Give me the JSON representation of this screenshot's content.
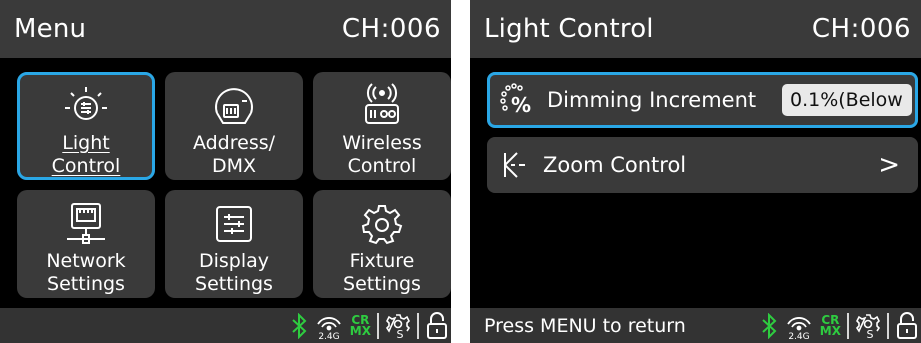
{
  "menu_screen": {
    "title": "Menu",
    "channel": "CH:006",
    "tiles": [
      {
        "label_1": "Light",
        "label_2": "Control",
        "icon": "light-control-icon"
      },
      {
        "label_1": "Address/",
        "label_2": "DMX",
        "icon": "dmx-connector-icon"
      },
      {
        "label_1": "Wireless",
        "label_2": "Control",
        "icon": "wireless-router-icon"
      },
      {
        "label_1": "Network",
        "label_2": "Settings",
        "icon": "network-port-icon"
      },
      {
        "label_1": "Display",
        "label_2": "Settings",
        "icon": "display-icon"
      },
      {
        "label_1": "Fixture",
        "label_2": "Settings",
        "icon": "gear-icon"
      }
    ],
    "selected_index": 0
  },
  "light_screen": {
    "title": "Light Control",
    "channel": "CH:006",
    "rows": [
      {
        "label": "Dimming Increment",
        "value": "0.1%(Below",
        "icon": "percent-dots-icon"
      },
      {
        "label": "Zoom Control",
        "icon": "zoom-beam-icon",
        "chevron": ">"
      }
    ],
    "hint": "Press MENU to return"
  },
  "status": {
    "bluetooth_icon": "bluetooth-icon",
    "wireless_band": "2.4G",
    "crmx_top": "CR",
    "crmx_bottom": "MX",
    "bluetooth_color": "#2ecc40",
    "crmx_color": "#2ecc40",
    "lock_icon": "unlock-icon",
    "fixture_icon": "gear-s-icon"
  },
  "colors": {
    "accent": "#2aa7e6",
    "panel": "#3a3a3a",
    "background": "#000000"
  }
}
